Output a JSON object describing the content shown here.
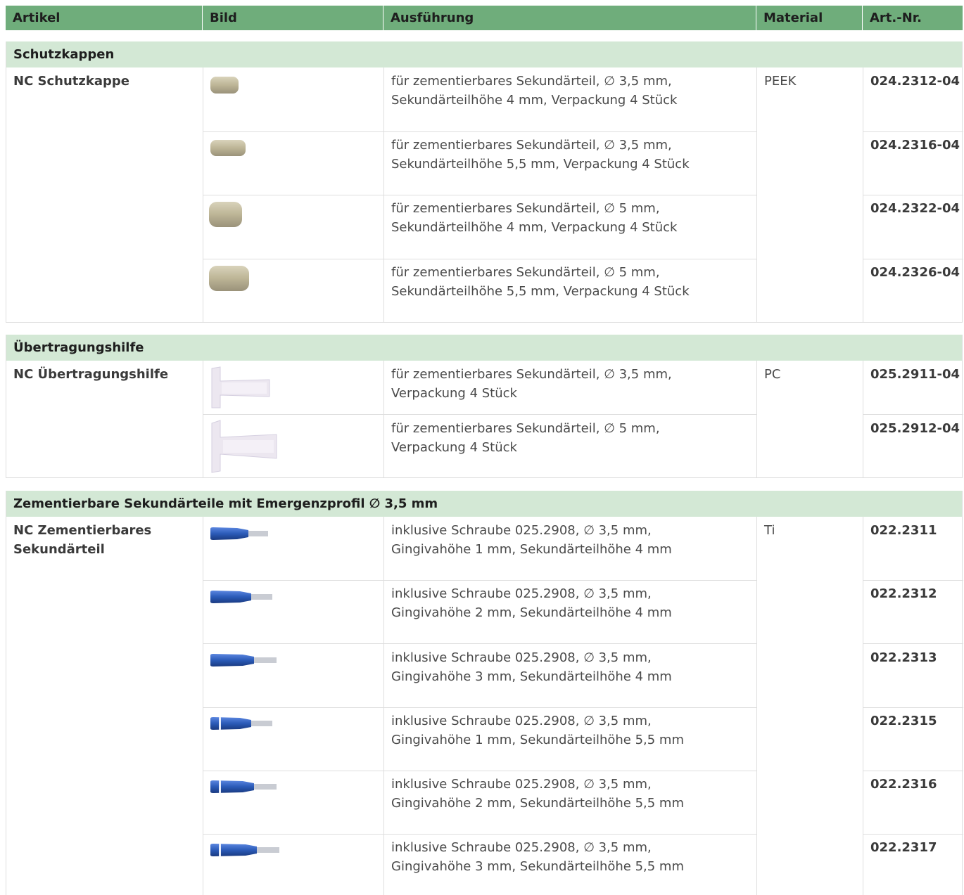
{
  "table_header": {
    "artikel": "Artikel",
    "bild": "Bild",
    "ausfuehrung": "Ausführung",
    "material": "Material",
    "artnr": "Art.-Nr."
  },
  "sections": [
    {
      "title": "Schutzkappen",
      "article": "NC Schutzkappe",
      "material": "PEEK",
      "rows": [
        {
          "line1": "für zementierbares Sekundärteil, ∅ 3,5 mm,",
          "line2": "Sekundärteilhöhe 4 mm, Verpackung 4 Stück",
          "artnr": "024.2312-04",
          "image": "protective-cap-small"
        },
        {
          "line1": "für zementierbares Sekundärteil, ∅ 3,5 mm,",
          "line2": "Sekundärteilhöhe 5,5 mm, Verpackung 4 Stück",
          "artnr": "024.2316-04",
          "image": "protective-cap-small-long"
        },
        {
          "line1": "für zementierbares Sekundärteil, ∅ 5 mm,",
          "line2": "Sekundärteilhöhe 4 mm, Verpackung 4 Stück",
          "artnr": "024.2322-04",
          "image": "protective-cap-large"
        },
        {
          "line1": "für zementierbares Sekundärteil, ∅ 5 mm,",
          "line2": "Sekundärteilhöhe 5,5 mm, Verpackung 4 Stück",
          "artnr": "024.2326-04",
          "image": "protective-cap-large-long"
        }
      ]
    },
    {
      "title": "Übertragungshilfe",
      "article": "NC Übertragungshilfe",
      "material": "PC",
      "rows": [
        {
          "line1": "für zementierbares Sekundärteil, ∅ 3,5 mm,",
          "line2": "Verpackung 4 Stück",
          "artnr": "025.2911-04",
          "image": "transfer-aid-small"
        },
        {
          "line1": "für zementierbares Sekundärteil, ∅ 5 mm,",
          "line2": "Verpackung 4 Stück",
          "artnr": "025.2912-04",
          "image": "transfer-aid-large"
        }
      ]
    },
    {
      "title": "Zementierbare Sekundärteile mit Emergenzprofil ∅ 3,5 mm",
      "article_line1": "NC Zementierbares",
      "article_line2": "Sekundärteil",
      "material": "Ti",
      "rows": [
        {
          "line1": "inklusive Schraube 025.2908, ∅ 3,5 mm,",
          "line2": "Gingivahöhe 1 mm, Sekundärteilhöhe 4 mm",
          "artnr": "022.2311",
          "image": "abutment-blue"
        },
        {
          "line1": "inklusive Schraube 025.2908, ∅ 3,5 mm,",
          "line2": "Gingivahöhe 2 mm, Sekundärteilhöhe 4 mm",
          "artnr": "022.2312",
          "image": "abutment-blue"
        },
        {
          "line1": "inklusive Schraube 025.2908, ∅ 3,5 mm,",
          "line2": "Gingivahöhe 3 mm, Sekundärteilhöhe 4 mm",
          "artnr": "022.2313",
          "image": "abutment-blue"
        },
        {
          "line1": "inklusive Schraube 025.2908, ∅ 3,5 mm,",
          "line2": "Gingivahöhe 1 mm, Sekundärteilhöhe 5,5 mm",
          "artnr": "022.2315",
          "image": "abutment-blue-ring"
        },
        {
          "line1": "inklusive Schraube 025.2908, ∅ 3,5 mm,",
          "line2": "Gingivahöhe 2 mm, Sekundärteilhöhe 5,5 mm",
          "artnr": "022.2316",
          "image": "abutment-blue-ring"
        },
        {
          "line1": "inklusive Schraube 025.2908, ∅ 3,5 mm,",
          "line2": "Gingivahöhe 3 mm, Sekundärteilhöhe 5,5 mm",
          "artnr": "022.2317",
          "image": "abutment-blue-ring"
        }
      ]
    }
  ],
  "colors": {
    "header_green": "#6fad7b",
    "section_green": "#d3e8d5",
    "grid_gray": "#dedede",
    "cap_beige": "#c9c1a4",
    "abutment_blue": "#2b5bb8"
  }
}
